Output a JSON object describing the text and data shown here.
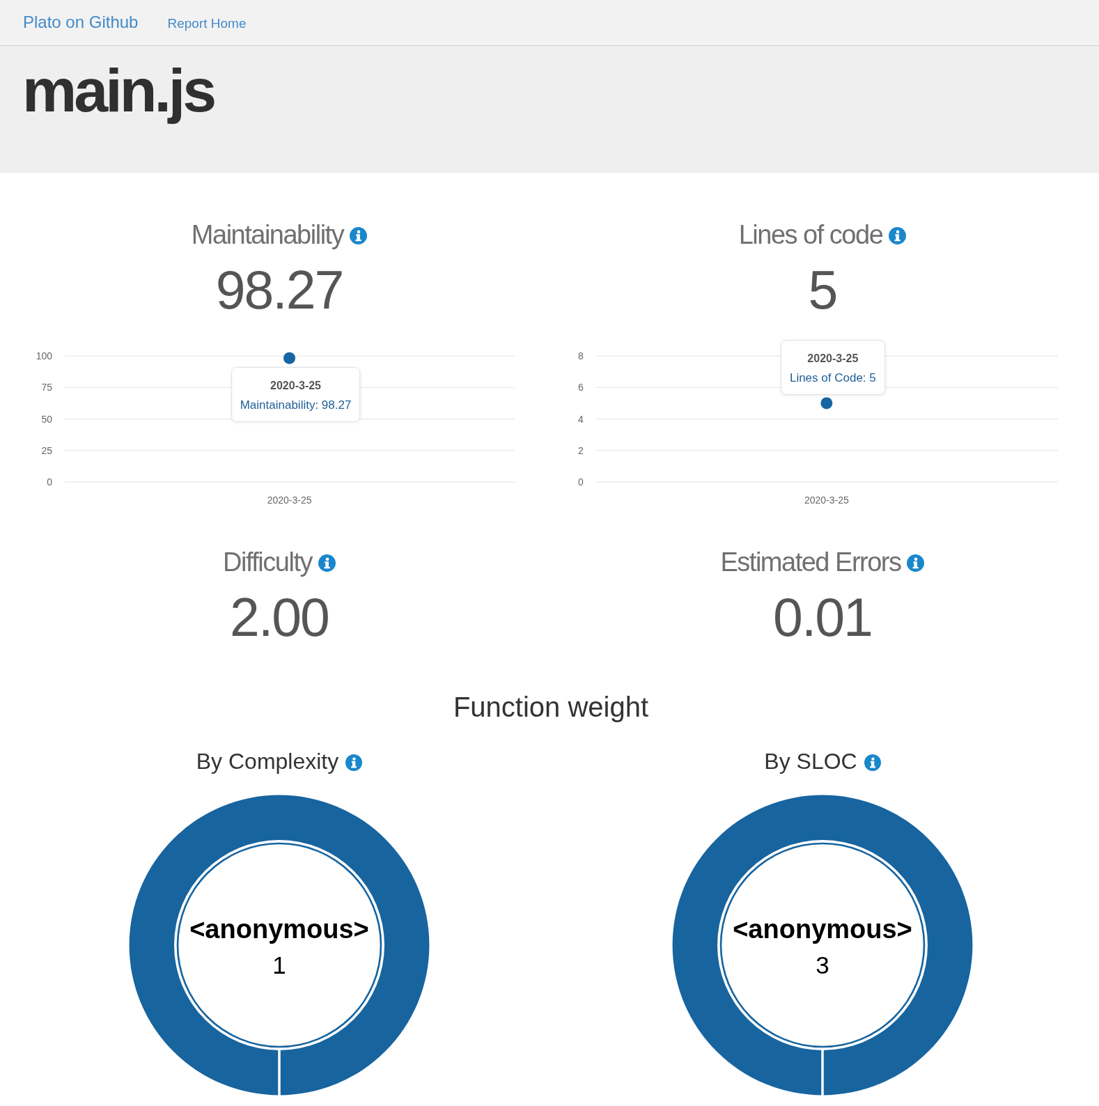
{
  "navbar": {
    "brand": "Plato on Github",
    "links": [
      "Report Home"
    ]
  },
  "header": {
    "title": "main.js"
  },
  "metrics": [
    {
      "title": "Maintainability",
      "value": "98.27",
      "chart_data": {
        "type": "scatter",
        "categories": [
          "2020-3-25"
        ],
        "values": [
          98.27
        ],
        "ylim": [
          0,
          100
        ],
        "yticks": [
          0,
          25,
          50,
          75,
          100
        ],
        "grid": true
      },
      "tooltip": {
        "title": "2020-3-25",
        "text": "Maintainability: 98.27"
      }
    },
    {
      "title": "Lines of code",
      "value": "5",
      "chart_data": {
        "type": "scatter",
        "categories": [
          "2020-3-25"
        ],
        "values": [
          5
        ],
        "ylim": [
          0,
          8
        ],
        "yticks": [
          0,
          2,
          4,
          6,
          8
        ],
        "grid": true
      },
      "tooltip": {
        "title": "2020-3-25",
        "text": "Lines of Code: 5"
      }
    },
    {
      "title": "Difficulty",
      "value": "2.00"
    },
    {
      "title": "Estimated Errors",
      "value": "0.01"
    }
  ],
  "function_weight": {
    "title": "Function weight",
    "charts": [
      {
        "title": "By Complexity",
        "chart_data": {
          "type": "donut",
          "categories": [
            "<anonymous>"
          ],
          "values": [
            1
          ],
          "data_labels": true
        }
      },
      {
        "title": "By SLOC",
        "chart_data": {
          "type": "donut",
          "categories": [
            "<anonymous>"
          ],
          "values": [
            3
          ],
          "data_labels": true
        }
      }
    ]
  }
}
